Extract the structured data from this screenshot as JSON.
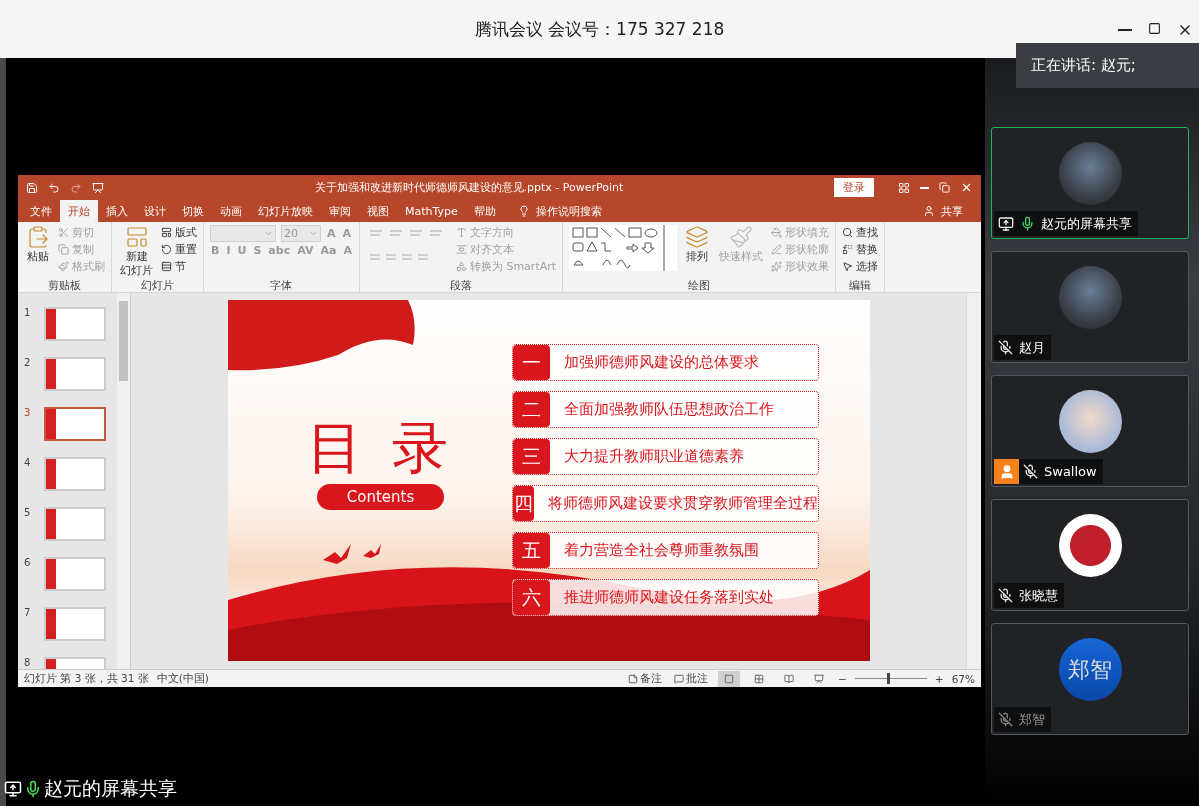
{
  "meeting": {
    "title": "腾讯会议 会议号：175 327 218",
    "speaking": "正在讲话: 赵元;",
    "share_label": "赵元的屏幕共享"
  },
  "ppt": {
    "title": "关于加强和改进新时代师德师风建设的意见.pptx  -  PowerPoint",
    "login": "登录",
    "tabs": [
      {
        "label": "文件",
        "selected": false
      },
      {
        "label": "开始",
        "selected": true
      },
      {
        "label": "插入",
        "selected": false
      },
      {
        "label": "设计",
        "selected": false
      },
      {
        "label": "切换",
        "selected": false
      },
      {
        "label": "动画",
        "selected": false
      },
      {
        "label": "幻灯片放映",
        "selected": false
      },
      {
        "label": "审阅",
        "selected": false
      },
      {
        "label": "视图",
        "selected": false
      },
      {
        "label": "MathType",
        "selected": false
      },
      {
        "label": "帮助",
        "selected": false
      }
    ],
    "tell_me": "操作说明搜索",
    "share": "共享",
    "groups": [
      {
        "label": "剪贴板",
        "items": [
          {
            "kind": "large",
            "label": "粘贴",
            "disabled": false
          },
          {
            "kind": "small",
            "label": "剪切",
            "disabled": true
          },
          {
            "kind": "small",
            "label": "复制",
            "disabled": true
          },
          {
            "kind": "small",
            "label": "格式刷",
            "disabled": true
          }
        ]
      },
      {
        "label": "幻灯片",
        "items": [
          {
            "kind": "large",
            "label": "新建",
            "sublabel": "幻灯片",
            "disabled": false
          },
          {
            "kind": "small",
            "label": "版式",
            "disabled": false
          },
          {
            "kind": "small",
            "label": "重置",
            "disabled": false
          },
          {
            "kind": "small",
            "label": "节",
            "disabled": false
          }
        ]
      },
      {
        "label": "字体",
        "items": [
          {
            "kind": "font",
            "size": "20",
            "grow": "A",
            "shrink": "A",
            "glyphs": [
              "B",
              "I",
              "U",
              "S",
              "abc",
              "AV",
              "Aa",
              "A"
            ]
          }
        ]
      },
      {
        "label": "段落",
        "items": [
          {
            "kind": "paragraph"
          },
          {
            "kind": "small",
            "label": "文字方向",
            "disabled": true
          },
          {
            "kind": "small",
            "label": "对齐文本",
            "disabled": true
          },
          {
            "kind": "small",
            "label": "转换为 SmartArt",
            "disabled": true
          }
        ]
      },
      {
        "label": "绘图",
        "items": [
          {
            "kind": "shapes"
          },
          {
            "kind": "large",
            "label": "排列",
            "disabled": false
          },
          {
            "kind": "large",
            "label": "快速样式",
            "disabled": true
          },
          {
            "kind": "small",
            "label": "形状填充",
            "disabled": true
          },
          {
            "kind": "small",
            "label": "形状轮廓",
            "disabled": true
          },
          {
            "kind": "small",
            "label": "形状效果",
            "disabled": true
          }
        ]
      },
      {
        "label": "编辑",
        "items": [
          {
            "kind": "small",
            "label": "查找",
            "disabled": false
          },
          {
            "kind": "small",
            "label": "替换",
            "disabled": false
          },
          {
            "kind": "small",
            "label": "选择",
            "disabled": false
          }
        ]
      }
    ],
    "thumbnails": [
      {
        "number": "1",
        "selected": false
      },
      {
        "number": "2",
        "selected": false
      },
      {
        "number": "3",
        "selected": true
      },
      {
        "number": "4",
        "selected": false
      },
      {
        "number": "5",
        "selected": false
      },
      {
        "number": "6",
        "selected": false
      },
      {
        "number": "7",
        "selected": false
      },
      {
        "number": "8",
        "selected": false
      }
    ],
    "slide": {
      "heading": "目 录",
      "subheading": "Contents",
      "entries": [
        {
          "numeral": "一",
          "text": "加强师德师风建设的总体要求"
        },
        {
          "numeral": "二",
          "text": "全面加强教师队伍思想政治工作"
        },
        {
          "numeral": "三",
          "text": "大力提升教师职业道德素养"
        },
        {
          "numeral": "四",
          "text": "将师德师风建设要求贯穿教师管理全过程"
        },
        {
          "numeral": "五",
          "text": "着力营造全社会尊师重教氛围"
        },
        {
          "numeral": "六",
          "text": "推进师德师风建设任务落到实处"
        }
      ]
    },
    "status": {
      "slide_info": "幻灯片 第 3 张，共 31 张",
      "language": "中文(中国)",
      "notes": "备注",
      "comments": "批注",
      "zoom_out": "−",
      "zoom": {
        "level": 0.45
      },
      "zoom_in": "+",
      "zoom_text": "67%"
    }
  },
  "participants": [
    {
      "name": "赵元的屏幕共享",
      "kind": "photo",
      "sharing": true,
      "muted": false,
      "active": true,
      "host": false,
      "dimmed": false
    },
    {
      "name": "赵月",
      "kind": "photo",
      "sharing": false,
      "muted": true,
      "active": false,
      "host": false,
      "dimmed": false
    },
    {
      "name": "Swallow",
      "kind": "cartoon",
      "sharing": false,
      "muted": true,
      "active": false,
      "host": true,
      "dimmed": false
    },
    {
      "name": "张晓慧",
      "kind": "apple",
      "sharing": false,
      "muted": true,
      "active": false,
      "host": false,
      "dimmed": false
    },
    {
      "name": "郑智",
      "kind": "text",
      "avatar_text": "郑智",
      "sharing": false,
      "muted": true,
      "active": false,
      "host": false,
      "dimmed": true
    }
  ]
}
